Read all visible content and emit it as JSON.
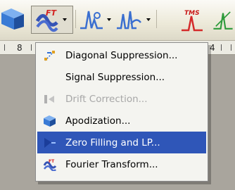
{
  "toolbar": {
    "buttons": [
      {
        "name": "apodization-tool",
        "has_dropdown": false
      },
      {
        "name": "processing-tool",
        "has_dropdown": true,
        "pressed": true,
        "badge": "FT"
      },
      {
        "name": "phase-tool",
        "has_dropdown": true
      },
      {
        "name": "baseline-tool",
        "has_dropdown": true
      },
      {
        "name": "peak-pick-tool",
        "has_dropdown": false,
        "badge": "TMS"
      },
      {
        "name": "integration-tool",
        "has_dropdown": false
      }
    ]
  },
  "ruler": {
    "left_label": "8",
    "right_label": "4"
  },
  "menu": {
    "items": [
      {
        "label": "Diagonal Suppression...",
        "icon": "diagonal-suppression-icon",
        "state": "normal"
      },
      {
        "label": "Signal Suppression...",
        "icon": "",
        "state": "normal"
      },
      {
        "label": "Drift Correction...",
        "icon": "drift-correction-icon",
        "state": "disabled"
      },
      {
        "label": "Apodization...",
        "icon": "apodization-icon",
        "state": "normal"
      },
      {
        "label": "Zero Filling and LP...",
        "icon": "zero-filling-icon",
        "state": "selected"
      },
      {
        "label": "Fourier Transform...",
        "icon": "fourier-transform-icon",
        "state": "normal"
      }
    ]
  },
  "colors": {
    "selection": "#2f56b8",
    "menu_bg": "#f4f4f0",
    "toolbar_bg": "#ece9d8",
    "disabled_text": "#a7a7a7"
  }
}
